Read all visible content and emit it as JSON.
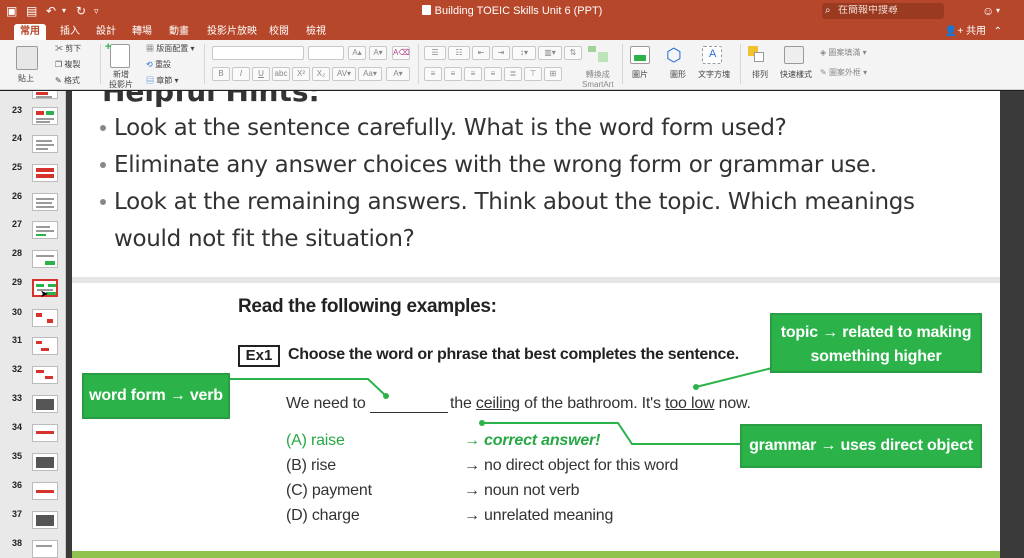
{
  "window": {
    "title": "Building TOEIC Skills Unit 6 (PPT)",
    "search_placeholder": "在簡報中搜尋",
    "share_label": "共用",
    "collapse_label": "⌃"
  },
  "tabs": [
    {
      "label": "常用",
      "active": true
    },
    {
      "label": "插入"
    },
    {
      "label": "設計"
    },
    {
      "label": "轉場"
    },
    {
      "label": "動畫"
    },
    {
      "label": "投影片放映"
    },
    {
      "label": "校閱"
    },
    {
      "label": "檢視"
    }
  ],
  "ribbon": {
    "paste": "貼上",
    "cut": "剪下",
    "copy": "複製",
    "format": "格式",
    "new_slide": "新增\n投影片",
    "layout": "版面配置",
    "reset": "重設",
    "section": "章節",
    "convert_smartart": "轉換成\nSmartArt",
    "picture": "圖片",
    "shape": "圖形",
    "textbox": "文字方塊",
    "arrange": "排列",
    "quick_styles": "快速樣式",
    "shape_fill": "圖案填滿",
    "shape_outline": "圖案外框"
  },
  "thumbnails": [
    {
      "num": "23"
    },
    {
      "num": "24"
    },
    {
      "num": "25"
    },
    {
      "num": "26"
    },
    {
      "num": "27"
    },
    {
      "num": "28"
    },
    {
      "num": "29",
      "selected": true
    },
    {
      "num": "30"
    },
    {
      "num": "31"
    },
    {
      "num": "32"
    },
    {
      "num": "33"
    },
    {
      "num": "34"
    },
    {
      "num": "35"
    },
    {
      "num": "36"
    },
    {
      "num": "37"
    },
    {
      "num": "38"
    }
  ],
  "slide": {
    "cut_title": "Helpful Hints:",
    "bullets": [
      "Look at the sentence carefully. What is the word form used?",
      "Eliminate any answer choices with the wrong form or grammar use.",
      "Look at the remaining answers. Think about the topic. Which meanings",
      "would not fit the situation?"
    ],
    "heading": "Read the following examples:",
    "ex_label": "Ex1",
    "instruction": "Choose the word or phrase that best completes the sentence.",
    "sentence": {
      "pre": "We need to",
      "mid": "the",
      "ceiling": "ceiling",
      "mid2": "of the bathroom. It's",
      "too_low": "too low",
      "post": "now."
    },
    "options": [
      {
        "label": "(A) raise",
        "note": "→ correct answer!",
        "correct": true
      },
      {
        "label": "(B) rise",
        "note": "→ no direct object for this word"
      },
      {
        "label": "(C) payment",
        "note": "→ noun not verb"
      },
      {
        "label": "(D) charge",
        "note": "→ unrelated meaning"
      }
    ],
    "callouts": {
      "word_form": "word form → verb",
      "topic_line1": "topic → related to making",
      "topic_line2": "something higher",
      "grammar": "grammar → uses direct object"
    }
  },
  "colors": {
    "brand": "#b7472a",
    "callout_green": "#2bb34a",
    "correct_green": "#27a844"
  }
}
